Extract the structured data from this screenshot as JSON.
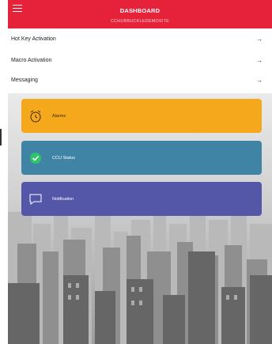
{
  "header": {
    "title": "DASHBOARD",
    "subtitle": "CCHUBBUCKLEDEMOSITE",
    "menu_icon": "hamburger-icon",
    "color": "#e5223a"
  },
  "nav": {
    "items": [
      {
        "label": "Hot Key Activation",
        "icon": "arrow-right-icon"
      },
      {
        "label": "Macro Activation",
        "icon": "arrow-right-icon"
      },
      {
        "label": "Messaging",
        "icon": "arrow-right-icon"
      }
    ],
    "arrow_glyph": "→"
  },
  "cards": [
    {
      "label": "Alarms",
      "icon": "alarm-clock-icon",
      "color": "#f6a81c"
    },
    {
      "label": "CCU Status",
      "icon": "check-circle-icon",
      "color": "#3f84a4"
    },
    {
      "label": "Notification",
      "icon": "chat-bubble-icon",
      "color": "#5457a8"
    }
  ]
}
